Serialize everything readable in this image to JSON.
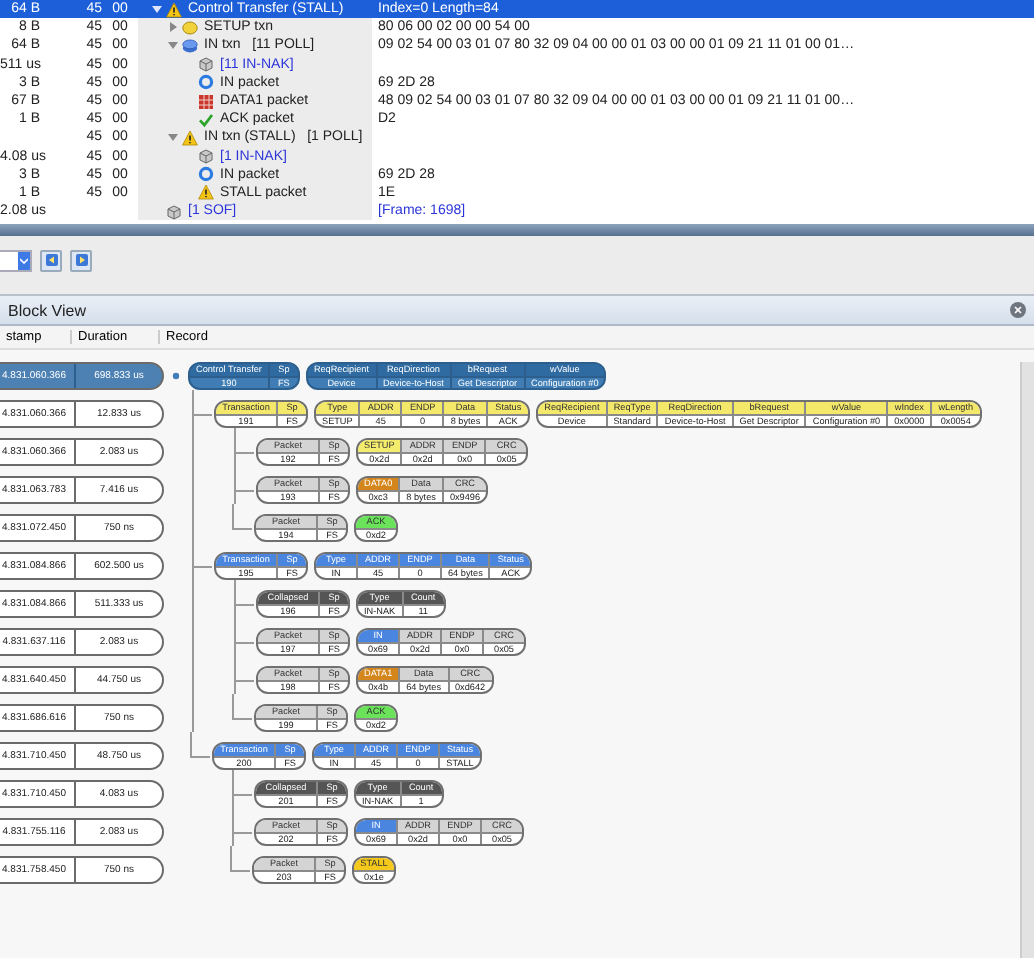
{
  "trace": {
    "rows": [
      {
        "column_1": "64 B",
        "column_2": "45",
        "column_3": "00",
        "kind": "warning",
        "label": "Control Transfer (STALL)",
        "column_5": "Index=0 Length=84",
        "expanded": true,
        "selected": true,
        "children": [
          {
            "column_1": "8 B",
            "column_2": "45",
            "column_3": "00",
            "kind": "setup",
            "label": "SETUP txn",
            "column_5": "80 06 00 02 00 00 54 00",
            "expanded": false,
            "selected": false
          },
          {
            "column_1": "64 B",
            "column_2": "45",
            "column_3": "00",
            "kind": "in",
            "label": "IN txn   [11 POLL]",
            "column_5": "09 02 54 00 03 01 07 80 32 09 04 00 00 01 03 00 00 01 09 21 11 01 00 01…",
            "expanded": true,
            "selected": false,
            "children": [
              {
                "column_1": "511 us",
                "column_2": "45",
                "column_3": "00",
                "kind": "nak",
                "label": "[11 IN-NAK]",
                "selected": false
              },
              {
                "column_1": "3 B",
                "column_2": "45",
                "column_3": "00",
                "kind": "packet-in",
                "label": "IN packet",
                "column_5": "69 2D 28",
                "selected": false
              },
              {
                "column_1": "67 B",
                "column_2": "45",
                "column_3": "00",
                "kind": "data",
                "label": "DATA1 packet",
                "column_5": "48 09 02 54 00 03 01 07 80 32 09 04 00 00 01 03 00 00 01 09 21 11 01 00…",
                "selected": false
              },
              {
                "column_1": "1 B",
                "column_2": "45",
                "column_3": "00",
                "kind": "ack",
                "label": "ACK packet",
                "column_5": "D2",
                "selected": false
              }
            ]
          },
          {
            "column_2": "45",
            "column_3": "00",
            "kind": "warning",
            "label": "IN txn (STALL)   [1 POLL]",
            "expanded": true,
            "selected": false,
            "children": [
              {
                "column_1": "4.08 us",
                "column_2": "45",
                "column_3": "00",
                "kind": "nak",
                "label": "[1 IN-NAK]",
                "selected": false
              },
              {
                "column_1": "3 B",
                "column_2": "45",
                "column_3": "00",
                "kind": "packet-in",
                "label": "IN packet",
                "column_5": "69 2D 28",
                "selected": false
              },
              {
                "column_1": "1 B",
                "column_2": "45",
                "column_3": "00",
                "kind": "warning",
                "label": "STALL packet",
                "column_5": "1E",
                "selected": false
              }
            ]
          }
        ]
      },
      {
        "column_1": "2.08 us",
        "kind": "sof",
        "label": "[1 SOF]",
        "column_5": "[Frame: 1698]",
        "selected": false
      }
    ]
  },
  "block_view": {
    "title": "Block View",
    "columns": [
      "stamp",
      "Duration",
      "Record"
    ],
    "records": [
      {
        "kind": "control",
        "timestamp": "4.831.060.366",
        "duration": "698.833 us",
        "selected": true,
        "name": [
          {
            "head": "Control Transfer",
            "value": "190"
          },
          {
            "head": "Sp",
            "value": "FS"
          }
        ],
        "field_groups": [
          [
            {
              "head": "ReqRecipient",
              "value": "Device"
            },
            {
              "head": "ReqDirection",
              "value": "Device-to-Host"
            },
            {
              "head": "bRequest",
              "value": "Get Descriptor"
            },
            {
              "head": "wValue",
              "value": "Configuration #0"
            }
          ]
        ],
        "children": [
          {
            "kind": "setup",
            "timestamp": "4.831.060.366",
            "duration": "12.833 us",
            "selected": false,
            "name": [
              {
                "head": "Transaction",
                "value": "191"
              },
              {
                "head": "Sp",
                "value": "FS"
              }
            ],
            "field_groups": [
              [
                {
                  "head": "Type",
                  "value": "SETUP"
                },
                {
                  "head": "ADDR",
                  "value": "45"
                },
                {
                  "head": "ENDP",
                  "value": "0"
                },
                {
                  "head": "Data",
                  "value": "8 bytes"
                },
                {
                  "head": "Status",
                  "value": "ACK"
                }
              ],
              [
                {
                  "head": "ReqRecipient",
                  "value": "Device"
                },
                {
                  "head": "ReqType",
                  "value": "Standard"
                },
                {
                  "head": "ReqDirection",
                  "value": "Device-to-Host"
                },
                {
                  "head": "bRequest",
                  "value": "Get Descriptor"
                },
                {
                  "head": "wValue",
                  "value": "Configuration #0"
                },
                {
                  "head": "wIndex",
                  "value": "0x0000"
                },
                {
                  "head": "wLength",
                  "value": "0x0054"
                }
              ]
            ],
            "children": [
              {
                "kind": "packet",
                "timestamp": "4.831.060.366",
                "duration": "2.083 us",
                "selected": false,
                "name": [
                  {
                    "head": "Packet",
                    "value": "192"
                  },
                  {
                    "head": "Sp",
                    "value": "FS"
                  }
                ],
                "field_groups": [
                  [
                    {
                      "head": "SETUP",
                      "value": "0x2d",
                      "color": "#f4ec6c"
                    },
                    {
                      "head": "ADDR",
                      "value": "0x2d"
                    },
                    {
                      "head": "ENDP",
                      "value": "0x0"
                    },
                    {
                      "head": "CRC",
                      "value": "0x05"
                    }
                  ]
                ]
              },
              {
                "kind": "packet",
                "timestamp": "4.831.063.783",
                "duration": "7.416 us",
                "selected": false,
                "name": [
                  {
                    "head": "Packet",
                    "value": "193"
                  },
                  {
                    "head": "Sp",
                    "value": "FS"
                  }
                ],
                "field_groups": [
                  [
                    {
                      "head": "DATA0",
                      "value": "0xc3",
                      "color": "#d4861c"
                    },
                    {
                      "head": "Data",
                      "value": "8 bytes"
                    },
                    {
                      "head": "CRC",
                      "value": "0x9496"
                    }
                  ]
                ]
              },
              {
                "kind": "packet",
                "timestamp": "4.831.072.450",
                "duration": "750 ns",
                "selected": false,
                "name": [
                  {
                    "head": "Packet",
                    "value": "194"
                  },
                  {
                    "head": "Sp",
                    "value": "FS"
                  }
                ],
                "field_groups": [
                  [
                    {
                      "head": "ACK",
                      "value": "0xd2",
                      "color": "#6ae25a"
                    }
                  ]
                ]
              }
            ]
          },
          {
            "kind": "in",
            "timestamp": "4.831.084.866",
            "duration": "602.500 us",
            "selected": false,
            "name": [
              {
                "head": "Transaction",
                "value": "195"
              },
              {
                "head": "Sp",
                "value": "FS"
              }
            ],
            "field_groups": [
              [
                {
                  "head": "Type",
                  "value": "IN"
                },
                {
                  "head": "ADDR",
                  "value": "45"
                },
                {
                  "head": "ENDP",
                  "value": "0"
                },
                {
                  "head": "Data",
                  "value": "64 bytes"
                },
                {
                  "head": "Status",
                  "value": "ACK"
                }
              ]
            ],
            "children": [
              {
                "kind": "collapsed",
                "timestamp": "4.831.084.866",
                "duration": "511.333 us",
                "selected": false,
                "name": [
                  {
                    "head": "Collapsed",
                    "value": "196"
                  },
                  {
                    "head": "Sp",
                    "value": "FS"
                  }
                ],
                "field_groups": [
                  [
                    {
                      "head": "Type",
                      "value": "IN-NAK"
                    },
                    {
                      "head": "Count",
                      "value": "11"
                    }
                  ]
                ]
              },
              {
                "kind": "packet",
                "timestamp": "4.831.637.116",
                "duration": "2.083 us",
                "selected": false,
                "name": [
                  {
                    "head": "Packet",
                    "value": "197"
                  },
                  {
                    "head": "Sp",
                    "value": "FS"
                  }
                ],
                "field_groups": [
                  [
                    {
                      "head": "IN",
                      "value": "0x69",
                      "color": "#4a86e0"
                    },
                    {
                      "head": "ADDR",
                      "value": "0x2d"
                    },
                    {
                      "head": "ENDP",
                      "value": "0x0"
                    },
                    {
                      "head": "CRC",
                      "value": "0x05"
                    }
                  ]
                ]
              },
              {
                "kind": "packet",
                "timestamp": "4.831.640.450",
                "duration": "44.750 us",
                "selected": false,
                "name": [
                  {
                    "head": "Packet",
                    "value": "198"
                  },
                  {
                    "head": "Sp",
                    "value": "FS"
                  }
                ],
                "field_groups": [
                  [
                    {
                      "head": "DATA1",
                      "value": "0x4b",
                      "color": "#d4861c"
                    },
                    {
                      "head": "Data",
                      "value": "64 bytes"
                    },
                    {
                      "head": "CRC",
                      "value": "0xd642"
                    }
                  ]
                ]
              },
              {
                "kind": "packet",
                "timestamp": "4.831.686.616",
                "duration": "750 ns",
                "selected": false,
                "name": [
                  {
                    "head": "Packet",
                    "value": "199"
                  },
                  {
                    "head": "Sp",
                    "value": "FS"
                  }
                ],
                "field_groups": [
                  [
                    {
                      "head": "ACK",
                      "value": "0xd2",
                      "color": "#6ae25a"
                    }
                  ]
                ]
              }
            ]
          },
          {
            "kind": "in",
            "timestamp": "4.831.710.450",
            "duration": "48.750 us",
            "selected": false,
            "name": [
              {
                "head": "Transaction",
                "value": "200"
              },
              {
                "head": "Sp",
                "value": "FS"
              }
            ],
            "field_groups": [
              [
                {
                  "head": "Type",
                  "value": "IN"
                },
                {
                  "head": "ADDR",
                  "value": "45"
                },
                {
                  "head": "ENDP",
                  "value": "0"
                },
                {
                  "head": "Status",
                  "value": "STALL"
                }
              ]
            ],
            "children": [
              {
                "kind": "collapsed",
                "timestamp": "4.831.710.450",
                "duration": "4.083 us",
                "selected": false,
                "name": [
                  {
                    "head": "Collapsed",
                    "value": "201"
                  },
                  {
                    "head": "Sp",
                    "value": "FS"
                  }
                ],
                "field_groups": [
                  [
                    {
                      "head": "Type",
                      "value": "IN-NAK"
                    },
                    {
                      "head": "Count",
                      "value": "1"
                    }
                  ]
                ]
              },
              {
                "kind": "packet",
                "timestamp": "4.831.755.116",
                "duration": "2.083 us",
                "selected": false,
                "name": [
                  {
                    "head": "Packet",
                    "value": "202"
                  },
                  {
                    "head": "Sp",
                    "value": "FS"
                  }
                ],
                "field_groups": [
                  [
                    {
                      "head": "IN",
                      "value": "0x69",
                      "color": "#4a86e0"
                    },
                    {
                      "head": "ADDR",
                      "value": "0x2d"
                    },
                    {
                      "head": "ENDP",
                      "value": "0x0"
                    },
                    {
                      "head": "CRC",
                      "value": "0x05"
                    }
                  ]
                ]
              },
              {
                "kind": "packet",
                "timestamp": "4.831.758.450",
                "duration": "750 ns",
                "selected": false,
                "name": [
                  {
                    "head": "Packet",
                    "value": "203"
                  },
                  {
                    "head": "Sp",
                    "value": "FS"
                  }
                ],
                "field_groups": [
                  [
                    {
                      "head": "STALL",
                      "value": "0x1e",
                      "color": "#f5c81c"
                    }
                  ]
                ]
              }
            ]
          }
        ]
      }
    ]
  }
}
